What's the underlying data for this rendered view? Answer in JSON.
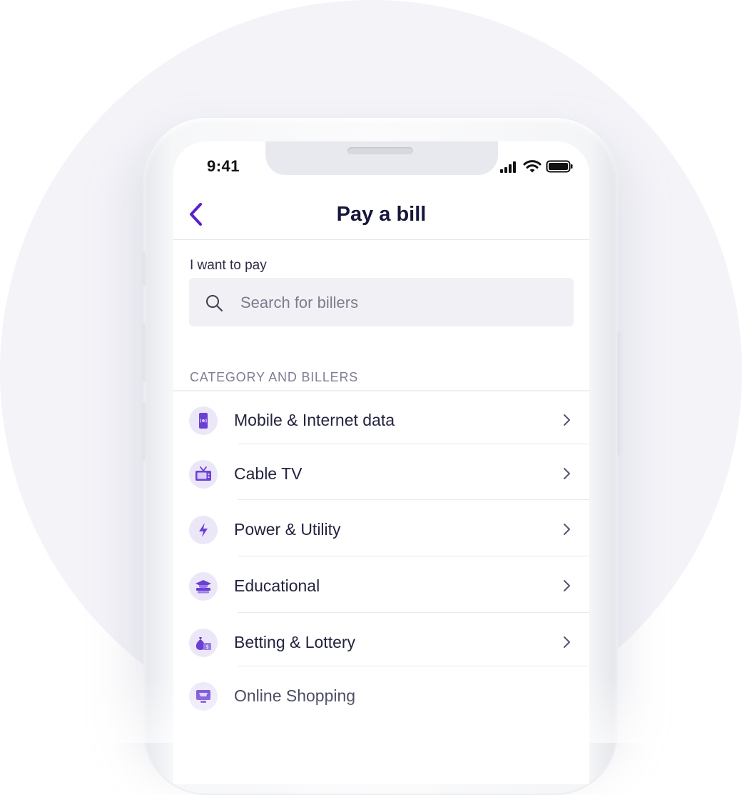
{
  "status_bar": {
    "time": "9:41"
  },
  "nav": {
    "title": "Pay a bill"
  },
  "form": {
    "label": "I want to pay",
    "search_placeholder": "Search for billers"
  },
  "section": {
    "label": "CATEGORY AND BILLERS"
  },
  "categories": [
    {
      "label": "Mobile & Internet data",
      "icon": "phone-icon"
    },
    {
      "label": "Cable TV",
      "icon": "tv-icon"
    },
    {
      "label": "Power & Utility",
      "icon": "lightning-icon"
    },
    {
      "label": "Educational",
      "icon": "graduation-cap-icon"
    },
    {
      "label": "Betting & Lottery",
      "icon": "money-bag-icon"
    },
    {
      "label": "Online Shopping",
      "icon": "shopping-cart-icon"
    }
  ],
  "colors": {
    "accent": "#5b1fcf",
    "icon_fill": "#7a4fdc",
    "icon_bg": "#ece7f8",
    "title": "#16173a",
    "background_circle": "#f3f3f8"
  }
}
